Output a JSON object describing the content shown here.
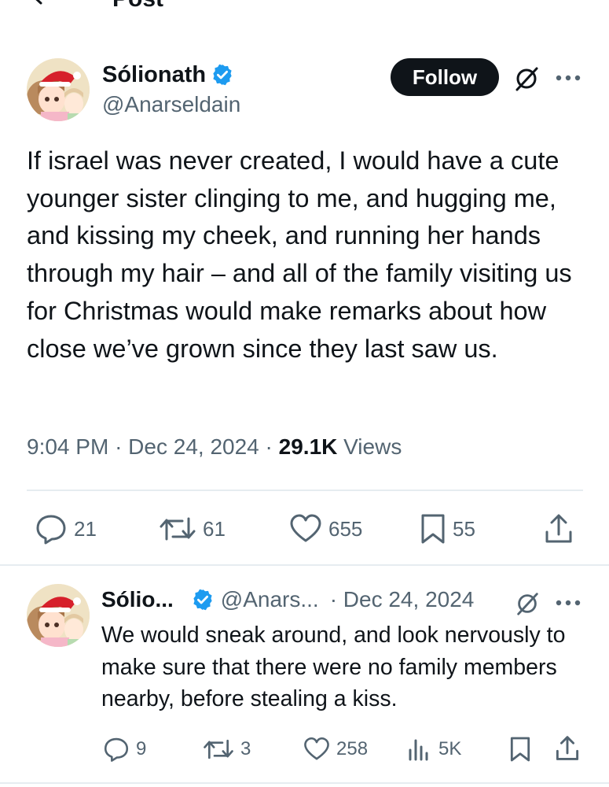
{
  "header": {
    "title": "Post"
  },
  "post": {
    "author": {
      "display_name": "Sólionath",
      "handle": "@Anarseldain",
      "verified": true
    },
    "follow_label": "Follow",
    "text": "If israel was never created, I would have a cute younger sister clinging to me, and hugging me, and kissing my cheek, and running her hands through my hair – and all of the family visiting us for Christmas would make remarks about how close we’ve grown since they last saw us.",
    "time": "9:04 PM",
    "date": "Dec 24, 2024",
    "views_count": "29.1K",
    "views_label": "Views",
    "stats": {
      "replies": "21",
      "reposts": "61",
      "likes": "655",
      "bookmarks": "55"
    }
  },
  "reply": {
    "author": {
      "display_name": "Sólio...",
      "handle": "@Anars...",
      "verified": true
    },
    "date": "· Dec 24, 2024",
    "text": "We would sneak around, and look nervously to make sure that there were no family members nearby, before stealing a kiss.",
    "stats": {
      "replies": "9",
      "reposts": "3",
      "likes": "258",
      "views": "5K"
    }
  },
  "colors": {
    "text": "#0f1419",
    "secondary": "#536471",
    "verified": "#1d9bf0",
    "divider": "#e6ecf0",
    "button": "#0f1419"
  }
}
